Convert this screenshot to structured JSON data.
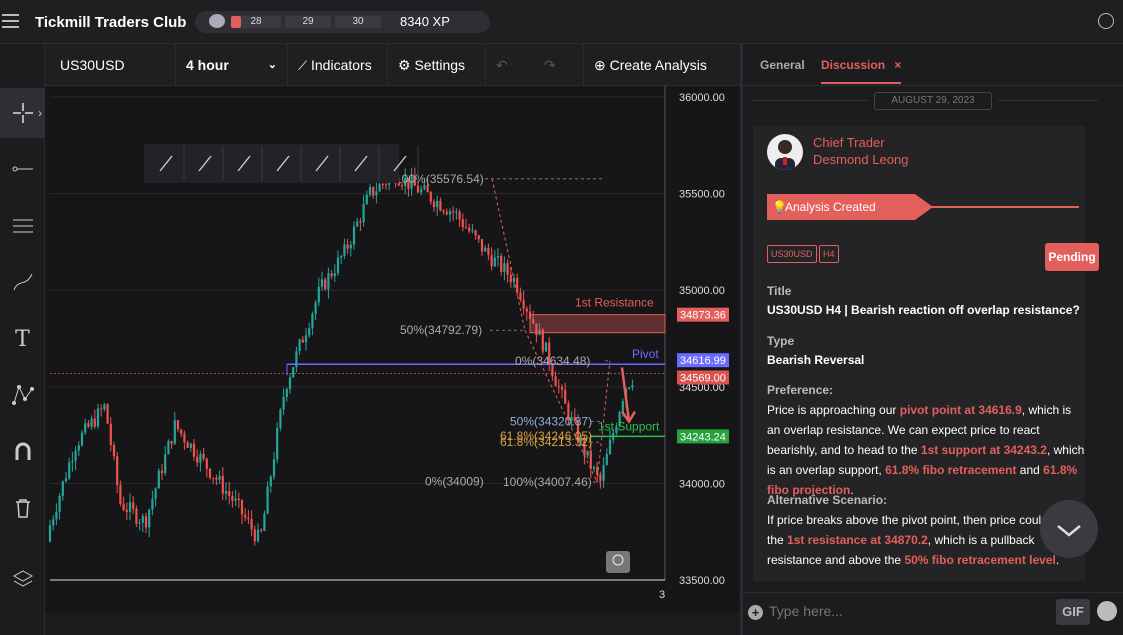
{
  "app": {
    "brand": "Tickmill Traders Club"
  },
  "xp": {
    "levels": [
      "28",
      "29",
      "30"
    ],
    "total": "8340 XP",
    "progress": 0.2
  },
  "toolbar": {
    "symbol": "US30USD",
    "timeframe": "4 hour",
    "indicators": "Indicators",
    "settings": "Settings",
    "create_analysis": "Create Analysis"
  },
  "left_tools": [
    "crosshair-icon",
    "line-icon",
    "fib-retracement-icon",
    "brush-icon",
    "text-icon",
    "pattern-icon",
    "magnet-icon",
    "trash-icon",
    "layers-icon"
  ],
  "chart_data": {
    "type": "candlestick",
    "symbol": "US30USD",
    "timeframe": "4 hour",
    "y_ticks": [
      "36000.00",
      "35500.00",
      "35000.00",
      "34500.00",
      "34000.00",
      "33500.00"
    ],
    "ylim": [
      33500,
      36000
    ],
    "x_tick": "3",
    "levels": [
      {
        "label": "1st Resistance",
        "price": "34873.36"
      },
      {
        "label": "Pivot",
        "price": "34616.99"
      },
      {
        "label": "",
        "price": "34569.00"
      },
      {
        "label": "1st Support",
        "price": "34243.24"
      }
    ],
    "fib_labels": [
      "100%(35576.54)",
      "50%(34792.79)",
      "0%(34634.48)",
      "50%(34320.87)",
      "61.8%(34246.05)",
      "61.8%(34213.32)",
      "0%(34009)",
      "100%(34007.46)"
    ],
    "colors": {
      "up": "#26a69a",
      "down": "#ef5350",
      "resistance": "#e35f5b",
      "pivot": "#6b6bff",
      "support": "#27c24c"
    }
  },
  "panel": {
    "tabs": [
      "General",
      "Discussion"
    ],
    "active_tab": "Discussion",
    "date": "AUGUST 29, 2023",
    "author_role": "Chief Trader",
    "author_name": "Desmond Leong",
    "banner": "Analysis Created",
    "tags": [
      "US30USD",
      "H4"
    ],
    "status": "Pending",
    "title_label": "Title",
    "title": "US30USD H4 | Bearish reaction off overlap resistance?",
    "type_label": "Type",
    "type": "Bearish Reversal",
    "preference_label": "Preference:",
    "preference": [
      {
        "t": "Price is approaching our ",
        "h": false
      },
      {
        "t": "pivot point at 34616.9",
        "h": true
      },
      {
        "t": ", which is an overlap resistance. We can expect price to react bearishly, and to head to the ",
        "h": false
      },
      {
        "t": "1st support at 34243.2",
        "h": true
      },
      {
        "t": ", which is an overlap support, ",
        "h": false
      },
      {
        "t": "61.8% fibo retracement",
        "h": true
      },
      {
        "t": " and ",
        "h": false
      },
      {
        "t": "61.8% fibo projection",
        "h": true
      },
      {
        "t": ".",
        "h": false
      }
    ],
    "alt_label": "Alternative Scenario:",
    "alternative": [
      {
        "t": "If price breaks above the pivot point, then price could rise to the ",
        "h": false
      },
      {
        "t": "1st resistance at 34870.2",
        "h": true
      },
      {
        "t": ", which is a pullback resistance and above the ",
        "h": false
      },
      {
        "t": "50% fibo retracement level",
        "h": true
      },
      {
        "t": ".",
        "h": false
      }
    ],
    "input_placeholder": "Type here...",
    "gif": "GIF"
  }
}
